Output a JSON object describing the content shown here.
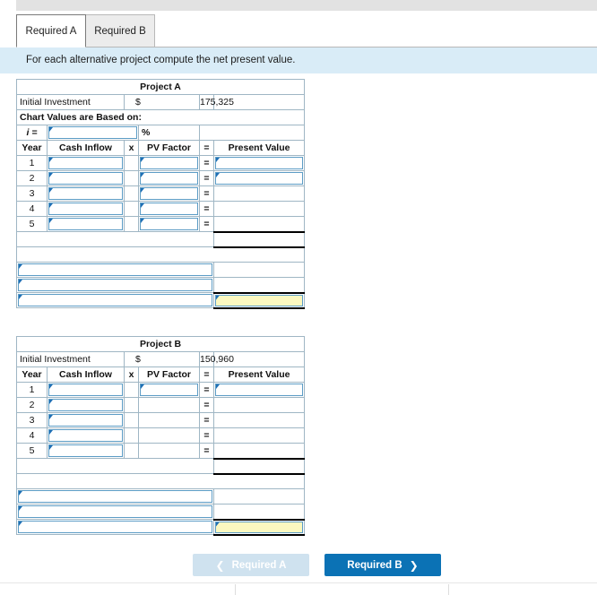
{
  "tabs": [
    {
      "label": "Required A",
      "active": true
    },
    {
      "label": "Required B",
      "active": false
    }
  ],
  "instruction": "For each alternative project compute the net present value.",
  "columns": {
    "year": "Year",
    "cash_inflow": "Cash Inflow",
    "times": "x",
    "pv_factor": "PV Factor",
    "equals": "=",
    "present_value": "Present Value"
  },
  "projects": [
    {
      "title": "Project A",
      "initial_investment_label": "Initial Investment",
      "currency_symbol": "$",
      "initial_investment_value": "175,325",
      "chart_values_label": "Chart Values are Based on:",
      "rate_label": "i =",
      "percent_symbol": "%",
      "rate_value": "",
      "rows": [
        {
          "year": "1",
          "cash_inflow": "",
          "pv_factor": "",
          "present_value": "",
          "has_pv_factor_input": true,
          "has_present_value_input": true
        },
        {
          "year": "2",
          "cash_inflow": "",
          "pv_factor": "",
          "present_value": "",
          "has_pv_factor_input": true,
          "has_present_value_input": true
        },
        {
          "year": "3",
          "cash_inflow": "",
          "pv_factor": "",
          "present_value": "",
          "has_pv_factor_input": true,
          "has_present_value_input": false
        },
        {
          "year": "4",
          "cash_inflow": "",
          "pv_factor": "",
          "present_value": "",
          "has_pv_factor_input": true,
          "has_present_value_input": false
        },
        {
          "year": "5",
          "cash_inflow": "",
          "pv_factor": "",
          "present_value": "",
          "has_pv_factor_input": true,
          "has_present_value_input": false
        }
      ],
      "summary_rows": [
        {
          "label": "",
          "value": "",
          "highlight": false
        },
        {
          "label": "",
          "value": "",
          "highlight": false
        },
        {
          "label": "",
          "value": "",
          "highlight": true
        }
      ]
    },
    {
      "title": "Project B",
      "initial_investment_label": "Initial Investment",
      "currency_symbol": "$",
      "initial_investment_value": "150,960",
      "rows": [
        {
          "year": "1",
          "cash_inflow": "",
          "pv_factor": "",
          "present_value": "",
          "has_pv_factor_input": true,
          "has_present_value_input": true
        },
        {
          "year": "2",
          "cash_inflow": "",
          "pv_factor": "",
          "present_value": "",
          "has_pv_factor_input": false,
          "has_present_value_input": false
        },
        {
          "year": "3",
          "cash_inflow": "",
          "pv_factor": "",
          "present_value": "",
          "has_pv_factor_input": false,
          "has_present_value_input": false
        },
        {
          "year": "4",
          "cash_inflow": "",
          "pv_factor": "",
          "present_value": "",
          "has_pv_factor_input": false,
          "has_present_value_input": false
        },
        {
          "year": "5",
          "cash_inflow": "",
          "pv_factor": "",
          "present_value": "",
          "has_pv_factor_input": false,
          "has_present_value_input": false
        }
      ],
      "summary_rows": [
        {
          "label": "",
          "value": "",
          "highlight": false
        },
        {
          "label": "",
          "value": "",
          "highlight": false
        },
        {
          "label": "",
          "value": "",
          "highlight": true
        }
      ]
    }
  ],
  "nav": {
    "prev_label": "Required A",
    "prev_icon": "chevron-left-icon",
    "prev_disabled": true,
    "next_label": "Required B",
    "next_icon": "chevron-right-icon"
  },
  "colors": {
    "header_blue": "#5eaee2",
    "banner_blue": "#d9ecf7",
    "primary_button": "#0b72b5",
    "disabled_button": "#cfe2ef",
    "input_border": "#5c9cc5",
    "highlight_yellow": "#fbf8c0"
  }
}
